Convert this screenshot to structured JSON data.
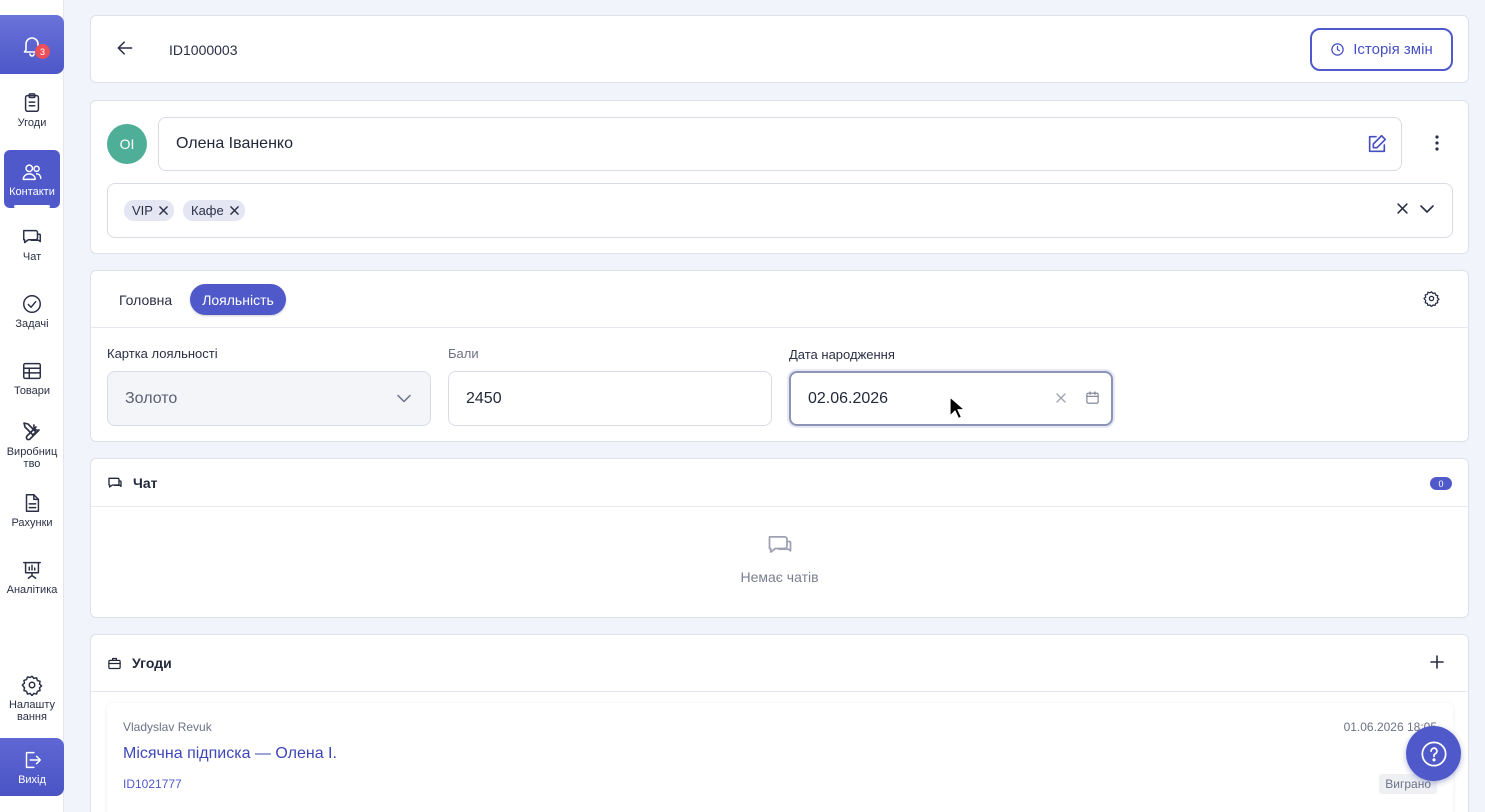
{
  "notifications": {
    "count": "3"
  },
  "sidebar": {
    "items": [
      {
        "label": "Угоди",
        "icon": "clipboard-icon"
      },
      {
        "label": "Контакти",
        "icon": "users-icon"
      },
      {
        "label": "Чат",
        "icon": "chat-icon"
      },
      {
        "label": "Задачі",
        "icon": "check-circle-icon"
      },
      {
        "label": "Товари",
        "icon": "table-icon"
      },
      {
        "label": "Виробниц\nтво",
        "label_l1": "Виробниц",
        "label_l2": "тво",
        "icon": "tools-icon"
      },
      {
        "label": "Рахунки",
        "icon": "document-icon"
      },
      {
        "label": "Аналітика",
        "icon": "presentation-chart-icon"
      },
      {
        "label_l1": "Налашту",
        "label_l2": "вання",
        "icon": "gear-icon"
      }
    ],
    "active": "Контакти",
    "exit_label": "Вихід"
  },
  "header": {
    "record_id": "ID1000003",
    "history_label": "Історія змін"
  },
  "contact": {
    "initials": "ОІ",
    "name": "Олена Іваненко",
    "tags": [
      "VIP",
      "Кафе"
    ]
  },
  "tabs": [
    {
      "label": "Головна",
      "active": false
    },
    {
      "label": "Лояльність",
      "active": true
    }
  ],
  "loyalty": {
    "card_label": "Картка лояльності",
    "card_value": "Золото",
    "points_label": "Бали",
    "points_value": "2450",
    "birthday_label": "Дата народження",
    "birthday_value": "02.06.2026"
  },
  "chat": {
    "title": "Чат",
    "count": "0",
    "empty_text": "Немає чатів"
  },
  "deals": {
    "title": "Угоди",
    "items": [
      {
        "author": "Vladyslav Revuk",
        "date": "01.06.2026 18:05",
        "title": "Місячна підписка — Олена І.",
        "id": "ID1021777",
        "status": "Виграно"
      }
    ]
  },
  "colors": {
    "accent": "#5059c9",
    "avatar": "#4fae98",
    "badge": "#e9505a"
  }
}
